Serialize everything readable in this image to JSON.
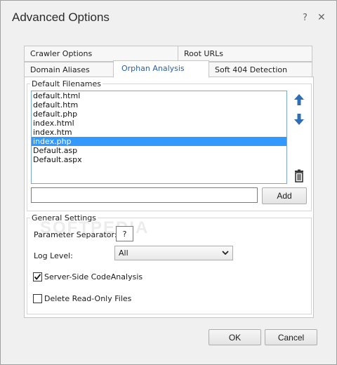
{
  "window": {
    "title": "Advanced Options",
    "help_glyph": "?",
    "close_glyph": "✕"
  },
  "tabs": {
    "row1": [
      {
        "label": "Crawler Options"
      },
      {
        "label": "Root URLs"
      }
    ],
    "row2": [
      {
        "label": "Domain Aliases"
      },
      {
        "label": "Orphan Analysis",
        "active": true
      },
      {
        "label": "Soft 404 Detection"
      }
    ]
  },
  "default_filenames": {
    "legend": "Default Filenames",
    "items": [
      {
        "label": "default.html"
      },
      {
        "label": "default.htm"
      },
      {
        "label": "default.php"
      },
      {
        "label": "index.html"
      },
      {
        "label": "index.htm"
      },
      {
        "label": "index.php",
        "selected": true
      },
      {
        "label": "Default.asp"
      },
      {
        "label": "Default.aspx"
      }
    ],
    "new_value": "",
    "add_label": "Add",
    "icons": {
      "move_up": "arrow-up-icon",
      "move_down": "arrow-down-icon",
      "delete": "trash-icon"
    }
  },
  "general_settings": {
    "legend": "General Settings",
    "param_separator_label": "Parameter Separator:",
    "param_separator_value": "?",
    "log_level_label": "Log Level:",
    "log_level_value": "All",
    "server_side_label": "Server-Side CodeAnalysis",
    "server_side_checked": true,
    "delete_readonly_label": "Delete Read-Only Files",
    "delete_readonly_checked": false
  },
  "footer": {
    "ok_label": "OK",
    "cancel_label": "Cancel"
  },
  "watermark": "SOFTPEDIA",
  "colors": {
    "accent": "#2a5ea8",
    "selection": "#3399ff",
    "icon_blue": "#2f6db5"
  }
}
